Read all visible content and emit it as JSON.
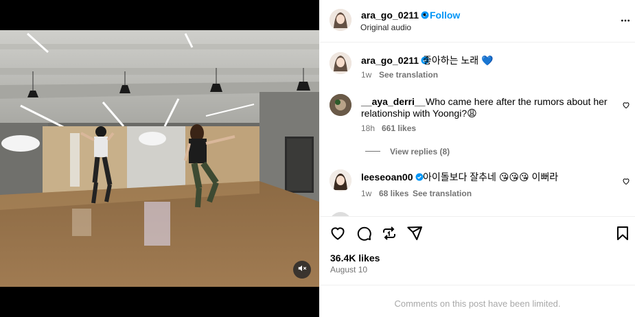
{
  "post": {
    "author": "ara_go_0211",
    "follow_label": "Follow",
    "dot": "•",
    "audio": "Original audio",
    "mute_state": "muted"
  },
  "caption": {
    "user": "ara_go_0211",
    "text": "좋아하는 노래",
    "emoji": "💙",
    "time": "1w",
    "translate": "See translation"
  },
  "comments": [
    {
      "user": "__aya_derri__",
      "line1": "Who came here after the rumors about her",
      "line2": "relationship with Yoongi?",
      "emoji": "😩",
      "time": "18h",
      "likes": "661 likes",
      "view_replies": "View replies (8)"
    },
    {
      "user": "leeseoan00",
      "text": "아이돌보다 잘추네",
      "emoji": "😘😘😘",
      "text2": "이뻐라",
      "time": "1w",
      "likes": "68 likes",
      "translate": "See translation"
    }
  ],
  "stats": {
    "likes": "36.4K likes",
    "date": "August 10"
  },
  "footer": {
    "limited": "Comments on this post have been limited."
  },
  "icons": {
    "verified_color": "#0095f6",
    "follow_color": "#0095f6"
  }
}
